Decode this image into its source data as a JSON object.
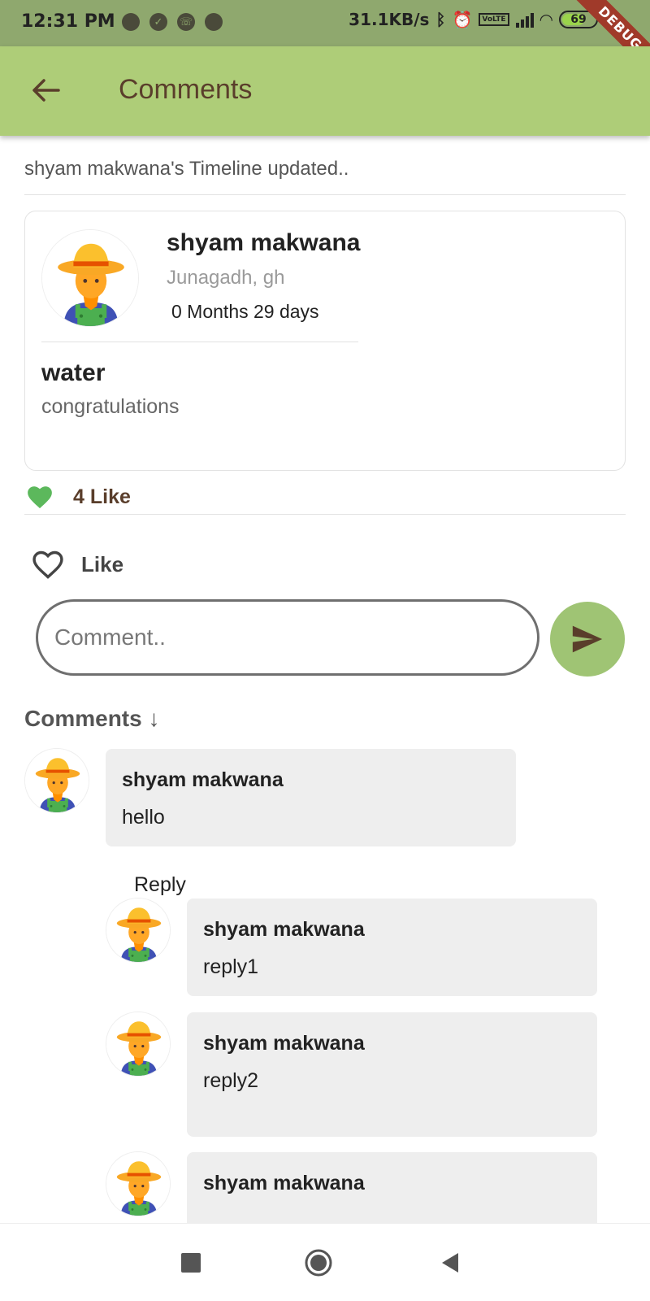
{
  "status_bar": {
    "time": "12:31 PM",
    "network_speed": "31.1KB/s",
    "battery": "69",
    "debug_banner": "DEBUG"
  },
  "app_bar": {
    "title": "Comments"
  },
  "timeline_note": "shyam makwana's Timeline updated..",
  "post": {
    "author": "shyam makwana",
    "location": "Junagadh, gh",
    "age": "0 Months  29 days",
    "heading": "water",
    "body": "congratulations"
  },
  "likes": {
    "count_label": "4 Like",
    "like_button_label": "Like"
  },
  "comment_input": {
    "placeholder": "Comment.."
  },
  "comments_header": "Comments ↓",
  "comments": [
    {
      "author": "shyam makwana",
      "text": "hello",
      "reply_label": "Reply"
    }
  ],
  "replies": [
    {
      "author": "shyam makwana",
      "text": "reply1"
    },
    {
      "author": "shyam makwana",
      "text": "reply2"
    },
    {
      "author": "shyam makwana",
      "text": ""
    }
  ],
  "colors": {
    "app_bar": "#aecd78",
    "status_bar": "#8fa86e",
    "title_text": "#5a3e2b",
    "heart_filled": "#5cb85c",
    "send_button": "#9fc474"
  }
}
